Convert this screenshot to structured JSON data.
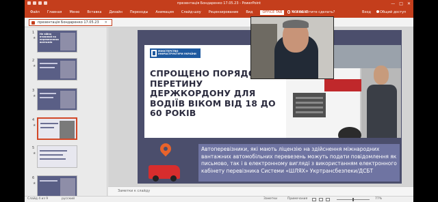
{
  "window": {
    "title": "презентація Бондаренко 17.05.23 - PowerPoint",
    "controls": [
      "—",
      "□",
      "✕"
    ]
  },
  "ribbon": {
    "tabs": [
      "Файл",
      "Главная",
      "Меню",
      "Вставка",
      "Дизайн",
      "Переходы",
      "Анимация",
      "Слайд-шоу",
      "Рецензирование",
      "Вид",
      "OFFICE TAB",
      "ACROBAT"
    ],
    "active_tab": "OFFICE TAB",
    "tell_me": "Что вы хотите сделать?",
    "login": "Вход",
    "share": "Общий доступ"
  },
  "document_tab": {
    "label": "презентація Бондаренко 17.05.23",
    "close": "✕"
  },
  "thumbnails": [
    {
      "num": "1",
      "title": "Не війна втомлюй на перевезеннях вантажів"
    },
    {
      "num": "2",
      "title": ""
    },
    {
      "num": "3",
      "title": ""
    },
    {
      "num": "4",
      "title": "",
      "active": true
    },
    {
      "num": "5",
      "title": ""
    },
    {
      "num": "6",
      "title": ""
    }
  ],
  "slide": {
    "ministry_label": "МІНІСТЕРСТВО ІНФРАСТРУКТУРИ УКРАЇНИ",
    "headline": "СПРОЩЕНО ПОРЯДОК ПЕРЕТИНУ ДЕРЖКОРДОНУ ДЛЯ ВОДІЇВ ВІКОМ ВІД 18 ДО 60 РОКІВ",
    "info": "Автоперевізники, які мають ліцензію на здійснення міжнародних вантажних автомобільних перевезень можуть подати повідомлення як письмово, так і в електронному вигляді з використанням електронного кабінету перевізника Системи «ШЛЯХ» Укртрансбезпеки/ДСБТ"
  },
  "notes": {
    "placeholder": "Заметки к слайду"
  },
  "status": {
    "slide_count": "Слайд 4 из 9",
    "language": "русский",
    "notes_btn": "Заметки",
    "comments_btn": "Примечания",
    "zoom": "77%"
  },
  "colors": {
    "brand": "#c43e1c",
    "slide_bg": "#4b4e6c",
    "info_box": "#6f74a2"
  }
}
